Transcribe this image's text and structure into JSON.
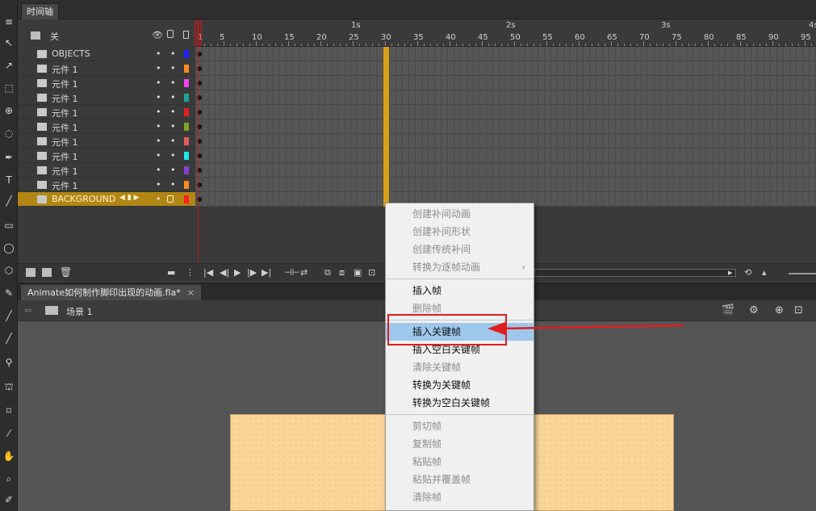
{
  "timeline": {
    "tab_title": "时间轴",
    "layer_header_label": "关",
    "layers": [
      {
        "name": "OBJECTS",
        "color": "#1e22ff"
      },
      {
        "name": "元件 1",
        "color": "#ff8a1e"
      },
      {
        "name": "元件 1",
        "color": "#ee44ee"
      },
      {
        "name": "元件 1",
        "color": "#1aa59b"
      },
      {
        "name": "元件 1",
        "color": "#e22020"
      },
      {
        "name": "元件 1",
        "color": "#7fa51f"
      },
      {
        "name": "元件 1",
        "color": "#e85a5a"
      },
      {
        "name": "元件 1",
        "color": "#19e8f0"
      },
      {
        "name": "元件 1",
        "color": "#8b3fd2"
      },
      {
        "name": "元件 1",
        "color": "#ff8a1e"
      },
      {
        "name": "BACKGROUND",
        "color": "#ff1e1e"
      }
    ],
    "dot": "•",
    "selected_layer_controls": "◀ ▮ ▶",
    "ruler_seconds": [
      "1s",
      "2s",
      "3s",
      "4s"
    ],
    "ruler_frames": [
      "1",
      "5",
      "10",
      "15",
      "20",
      "25",
      "30",
      "35",
      "40",
      "45",
      "50",
      "55",
      "60",
      "65",
      "70",
      "75",
      "80",
      "85",
      "90",
      "95"
    ]
  },
  "document": {
    "tab_title": "Animate如何制作脚印出现的动画.fla*",
    "tab_close": "×",
    "scene_label": "场景 1",
    "back_arrow": "⇦"
  },
  "context_menu": {
    "items": [
      {
        "label": "创建补间动画",
        "disabled": true
      },
      {
        "label": "创建补间形状",
        "disabled": true
      },
      {
        "label": "创建传统补间",
        "disabled": true
      },
      {
        "label": "转换为逐帧动画",
        "disabled": true,
        "submenu": "›"
      },
      {
        "label": "插入帧",
        "disabled": false
      },
      {
        "label": "删除帧",
        "disabled": true
      },
      {
        "label": "插入关键帧",
        "disabled": false,
        "highlighted": true
      },
      {
        "label": "插入空白关键帧",
        "disabled": false
      },
      {
        "label": "清除关键帧",
        "disabled": true
      },
      {
        "label": "转换为关键帧",
        "disabled": false
      },
      {
        "label": "转换为空白关键帧",
        "disabled": false
      },
      {
        "label": "剪切帧",
        "disabled": true
      },
      {
        "label": "复制帧",
        "disabled": true
      },
      {
        "label": "粘贴帧",
        "disabled": true
      },
      {
        "label": "粘贴并覆盖帧",
        "disabled": true
      },
      {
        "label": "清除帧",
        "disabled": true
      }
    ]
  },
  "colors": {
    "annotation_red": "#e11c1c",
    "menu_highlight": "#9ec7ec",
    "selected_layer": "#b18613",
    "frame_30_marker": "#d8a21a",
    "stage": "#f9d59a"
  }
}
